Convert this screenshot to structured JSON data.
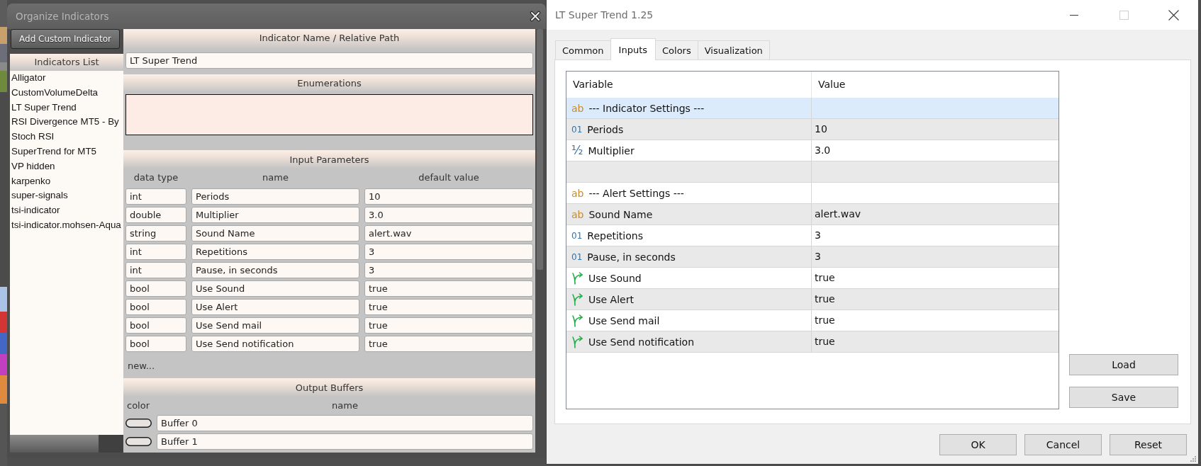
{
  "organize_window": {
    "title": "Organize Indicators",
    "add_button": "Add Custom Indicator",
    "indicators_list": {
      "title": "Indicators List",
      "items": [
        {
          "label": "Alligator",
          "selected": false
        },
        {
          "label": "CustomVolumeDelta",
          "selected": false
        },
        {
          "label": "LT Super Trend",
          "selected": false
        },
        {
          "label": "RSI Divergence MT5 - By",
          "selected": false
        },
        {
          "label": "Stoch RSI",
          "selected": false
        },
        {
          "label": "SuperTrend for MT5",
          "selected": false
        },
        {
          "label": "VP hidden",
          "selected": false
        },
        {
          "label": "karpenko",
          "selected": false
        },
        {
          "label": "super-signals",
          "selected": false
        },
        {
          "label": "tsi-indicator",
          "selected": false
        },
        {
          "label": "tsi-indicator.mohsen-Aqua",
          "selected": false
        }
      ]
    },
    "name_section": {
      "title": "Indicator Name / Relative Path",
      "value": "LT Super Trend"
    },
    "enumerations": {
      "title": "Enumerations"
    },
    "input_parameters": {
      "title": "Input Parameters",
      "columns": [
        "data type",
        "name",
        "default value"
      ],
      "rows": [
        {
          "data_type": "int",
          "name": "Periods",
          "default_value": "10"
        },
        {
          "data_type": "double",
          "name": "Multiplier",
          "default_value": "3.0"
        },
        {
          "data_type": "string",
          "name": "Sound Name",
          "default_value": "alert.wav"
        },
        {
          "data_type": "int",
          "name": "Repetitions",
          "default_value": "3"
        },
        {
          "data_type": "int",
          "name": "Pause, in seconds",
          "default_value": "3"
        },
        {
          "data_type": "bool",
          "name": "Use Sound",
          "default_value": "true"
        },
        {
          "data_type": "bool",
          "name": "Use Alert",
          "default_value": "true"
        },
        {
          "data_type": "bool",
          "name": "Use Send mail",
          "default_value": "true"
        },
        {
          "data_type": "bool",
          "name": "Use Send notification",
          "default_value": "true"
        }
      ],
      "new_label": "new..."
    },
    "output_buffers": {
      "title": "Output Buffers",
      "columns": [
        "color",
        "name"
      ],
      "rows": [
        {
          "name": "Buffer 0"
        },
        {
          "name": "Buffer 1"
        }
      ]
    }
  },
  "properties_dialog": {
    "title": "LT Super Trend 1.25",
    "tabs": [
      {
        "label": "Common",
        "selected": false
      },
      {
        "label": "Inputs",
        "selected": true
      },
      {
        "label": "Colors",
        "selected": false
      },
      {
        "label": "Visualization",
        "selected": false
      }
    ],
    "grid": {
      "columns": [
        "Variable",
        "Value"
      ],
      "rows": [
        {
          "kind": "string",
          "icon": "ab",
          "variable": "--- Indicator Settings ---",
          "selected": true
        },
        {
          "kind": "integer",
          "icon": "01",
          "variable": "Periods",
          "value": "10",
          "selected": false
        },
        {
          "kind": "double",
          "icon": "½",
          "variable": "Multiplier",
          "value": "3.0",
          "selected": false
        },
        {
          "kind": "blank",
          "selected": false
        },
        {
          "kind": "string",
          "icon": "ab",
          "variable": "--- Alert Settings ---",
          "selected": false
        },
        {
          "kind": "string",
          "icon": "ab",
          "variable": "Sound Name",
          "value": "alert.wav",
          "selected": false
        },
        {
          "kind": "integer",
          "icon": "01",
          "variable": "Repetitions",
          "value": "3",
          "selected": false
        },
        {
          "kind": "integer",
          "icon": "01",
          "variable": "Pause, in seconds",
          "value": "3",
          "selected": false
        },
        {
          "kind": "bool",
          "variable": "Use Sound",
          "value": "true",
          "selected": false
        },
        {
          "kind": "bool",
          "variable": "Use Alert",
          "value": "true",
          "selected": false
        },
        {
          "kind": "bool",
          "variable": "Use Send mail",
          "value": "true",
          "selected": false
        },
        {
          "kind": "bool",
          "variable": "Use Send notification",
          "value": "true",
          "selected": false
        }
      ]
    },
    "side_buttons": [
      "Load",
      "Save"
    ],
    "footer_buttons": [
      "OK",
      "Cancel",
      "Reset"
    ]
  }
}
